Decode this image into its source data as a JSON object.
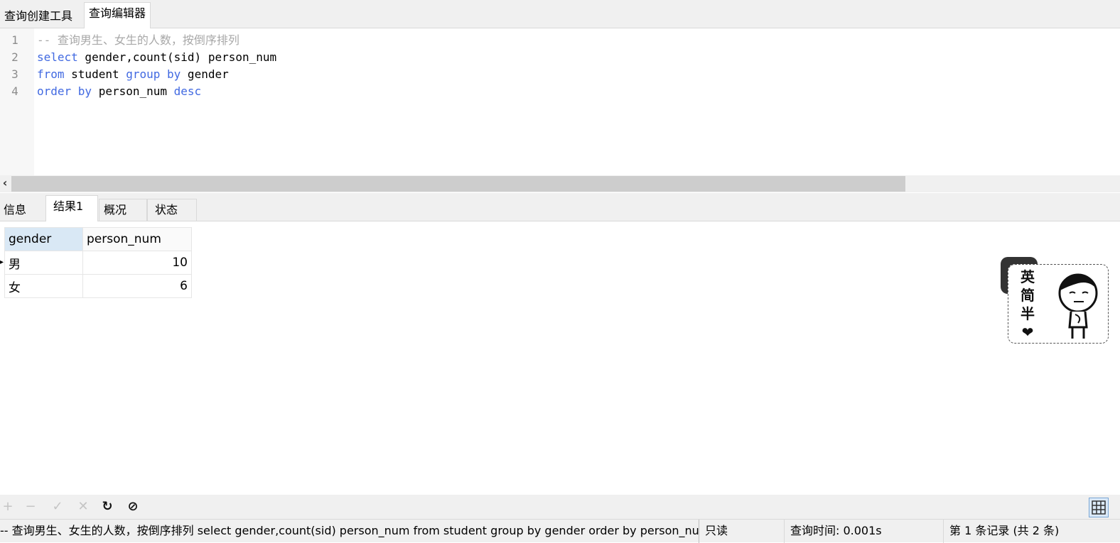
{
  "top_tabs": [
    "查询创建工具",
    "查询编辑器"
  ],
  "editor": {
    "lines": [
      {
        "num": "1",
        "tokens": [
          {
            "t": "-- 查询男生、女生的人数，按倒序排列",
            "c": "cm"
          }
        ]
      },
      {
        "num": "2",
        "tokens": [
          {
            "t": "select",
            "c": "kw"
          },
          {
            "t": " gender,count(sid) person_num",
            "c": "tx"
          }
        ]
      },
      {
        "num": "3",
        "tokens": [
          {
            "t": "from",
            "c": "kw"
          },
          {
            "t": " student ",
            "c": "tx"
          },
          {
            "t": "group by",
            "c": "kw"
          },
          {
            "t": " gender",
            "c": "tx"
          }
        ]
      },
      {
        "num": "4",
        "tokens": [
          {
            "t": "order by",
            "c": "kw"
          },
          {
            "t": " person_num ",
            "c": "tx"
          },
          {
            "t": "desc",
            "c": "kw"
          }
        ]
      }
    ]
  },
  "scrollbar": {
    "left_arrow": "‹"
  },
  "result_tabs": [
    "信息",
    "结果1",
    "概况",
    "状态"
  ],
  "grid": {
    "columns": [
      "gender",
      "person_num"
    ],
    "rows": [
      [
        "男",
        "10"
      ],
      [
        "女",
        "6"
      ]
    ],
    "current_row_marker": "▸"
  },
  "sticker": {
    "text": [
      "英",
      "简",
      "半",
      "❤"
    ]
  },
  "toolbar": {
    "add": "+",
    "remove": "−",
    "apply": "✓",
    "discard": "✕",
    "refresh": "↻",
    "stop": "⊘"
  },
  "status": {
    "sql": "-- 查询男生、女生的人数，按倒序排列 select gender,count(sid) person_num  from student group by gender  order by person_num desc",
    "readonly": "只读",
    "query_time": "查询时间: 0.001s",
    "record": "第 1 条记录 (共 2 条)"
  }
}
